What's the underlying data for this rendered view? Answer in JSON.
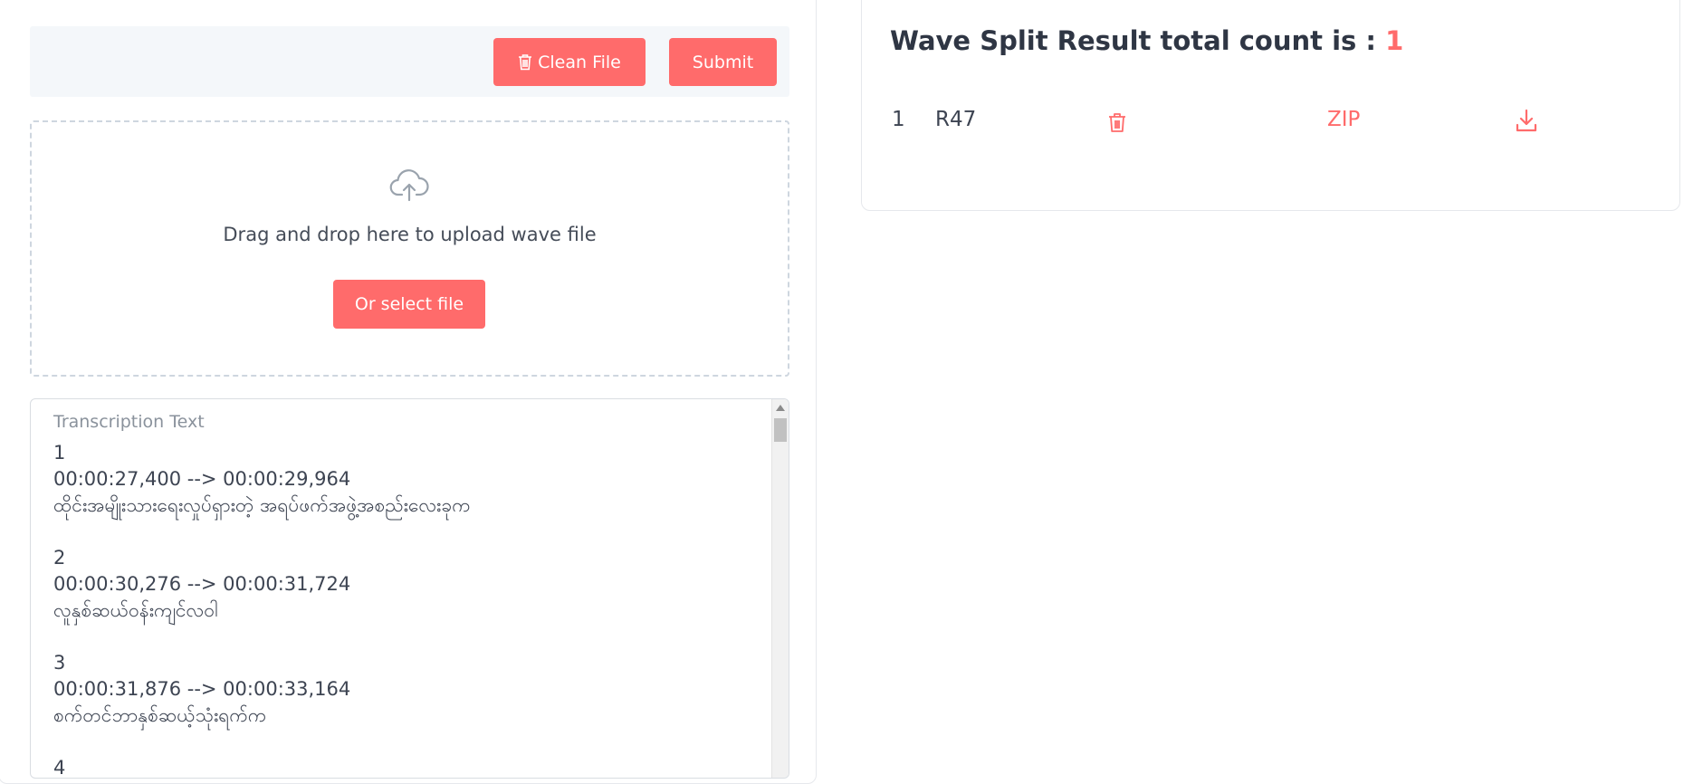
{
  "toolbar": {
    "clean_label": "Clean File",
    "submit_label": "Submit",
    "clean_icon": "trash-icon"
  },
  "dropzone": {
    "icon": "cloud-upload-icon",
    "text": "Drag and drop here to upload wave file",
    "select_label": "Or select file"
  },
  "transcription": {
    "label": "Transcription Text",
    "content": "1\n00:00:27,400 --> 00:00:29,964\nထိုင်းအမျိုးသားရေးလှုပ်ရှားတဲ့ အရပ်ဖက်အဖွဲ့အစည်းလေးခုက\n\n2\n00:00:30,276 --> 00:00:31,724\nလူနှစ်ဆယ်ဝန်းကျင်လ၀ါ\n\n3\n00:00:31,876 --> 00:00:33,164\nစက်တင်ဘာနှစ်ဆယ့်သုံးရက်က\n\n4"
  },
  "results": {
    "title": "Wave Split Result total count is : ",
    "count": "1",
    "rows": [
      {
        "index": "1",
        "name": "R47",
        "delete_icon": "trash-icon",
        "format": "ZIP",
        "download_icon": "download-icon"
      }
    ]
  },
  "colors": {
    "accent": "#ff6b6b",
    "toolbar_bg": "#f4f7fa",
    "text": "#3d4452"
  }
}
